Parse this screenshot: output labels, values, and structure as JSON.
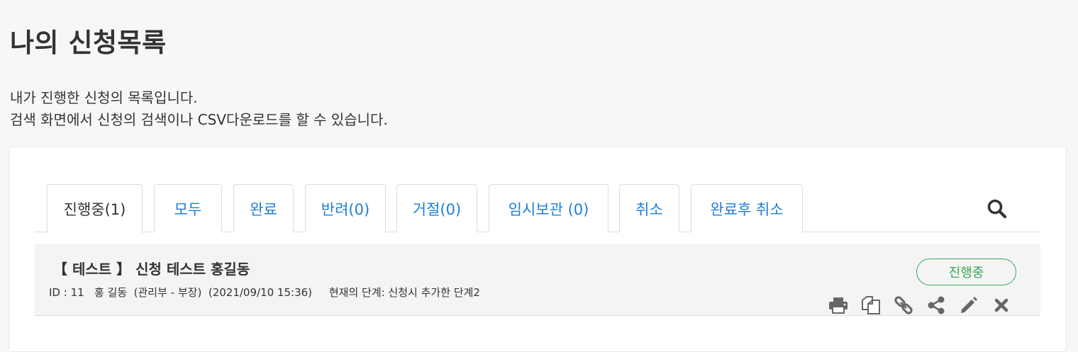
{
  "header": {
    "title": "나의 신청목록",
    "desc_line1": "내가 진행한 신청의 목록입니다.",
    "desc_line2": "검색 화면에서 신청의 검색이나 CSV다운로드를 할 수 있습니다."
  },
  "tabs": [
    {
      "label": "진행중(1)",
      "active": true
    },
    {
      "label": "모두"
    },
    {
      "label": "완료"
    },
    {
      "label": "반려(0)"
    },
    {
      "label": "거절(0)"
    },
    {
      "label": "임시보관 (0)"
    },
    {
      "label": "취소"
    },
    {
      "label": "완료후 취소"
    }
  ],
  "search_icon": "search-icon",
  "items": [
    {
      "title": "【 테스트 】 신청 테스트 홍길동",
      "meta": "ID : 11   홍 길동  (관리부 - 부장)  (2021/09/10 15:36)     현재의 단계: 신청시 추가한 단계2",
      "status": "진행중",
      "status_color": "#3aa655",
      "actions": [
        "print-icon",
        "copy-icon",
        "link-icon",
        "share-icon",
        "edit-icon",
        "delete-icon"
      ]
    }
  ],
  "colors": {
    "link": "#1e7fd8",
    "icon": "#666666"
  }
}
